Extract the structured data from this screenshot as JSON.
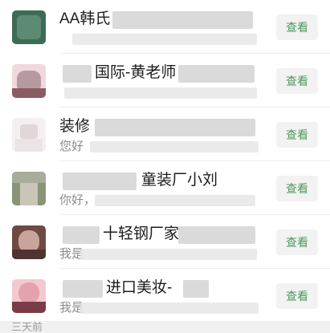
{
  "contacts": [
    {
      "name": "AA韩氏",
      "message": "",
      "button": "查看"
    },
    {
      "name": "国际-黄老师",
      "message": "",
      "button": "查看"
    },
    {
      "name": "装修",
      "message": "您好",
      "button": "查看"
    },
    {
      "name": "童装厂小刘",
      "message": "你好，",
      "button": "查看"
    },
    {
      "name": "十轻钢厂家",
      "message": "我是",
      "button": "查看"
    },
    {
      "name": "进口美妆-",
      "message": "我是",
      "button": "查看"
    }
  ],
  "footer": {
    "label": "三天前"
  }
}
